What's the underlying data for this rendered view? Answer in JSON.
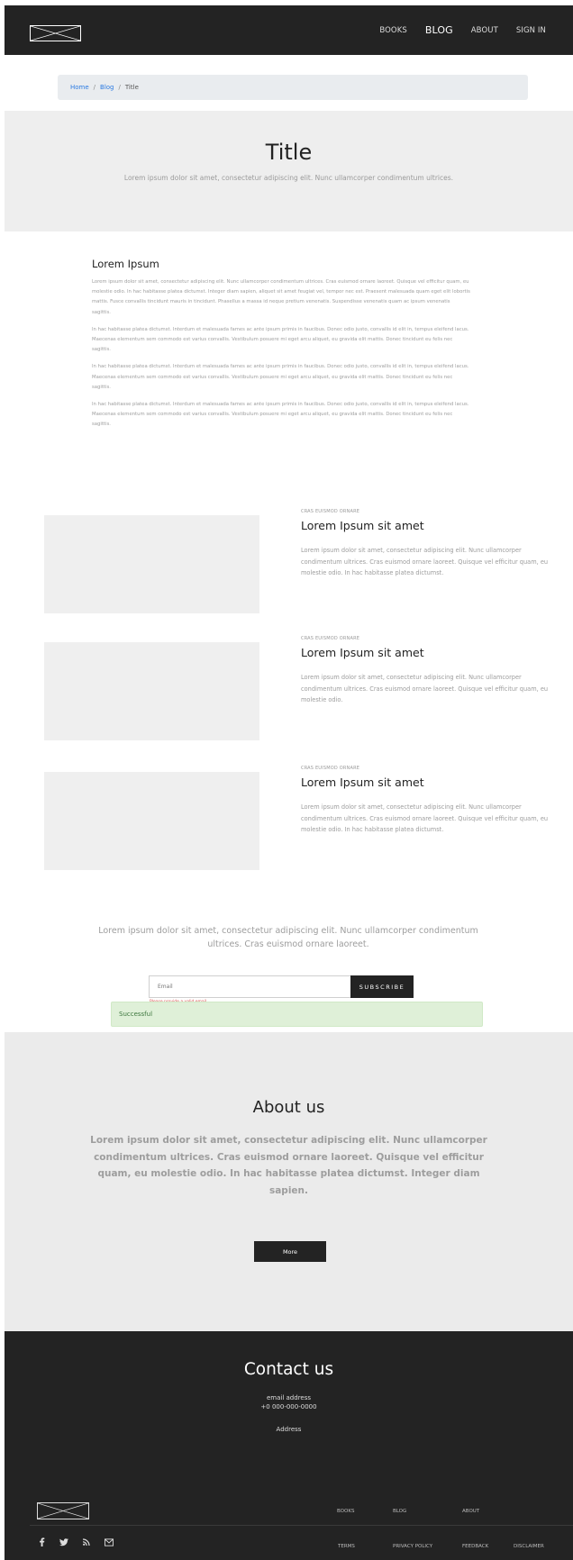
{
  "header": {
    "nav": [
      {
        "label": "BOOKS",
        "active": false
      },
      {
        "label": "BLOG",
        "active": true
      },
      {
        "label": "ABOUT",
        "active": false
      },
      {
        "label": "SIGN IN",
        "active": false
      }
    ]
  },
  "breadcrumb": {
    "home": "Home",
    "blog": "Blog",
    "current": "Title",
    "separator": "/"
  },
  "hero": {
    "title": "Title",
    "subtitle": "Lorem ipsum dolor sit amet, consectetur adipiscing elit. Nunc ullamcorper condimentum ultrices."
  },
  "article": {
    "heading": "Lorem Ipsum",
    "paragraphs": [
      "Lorem ipsum dolor sit amet, consectetur adipiscing elit. Nunc ullamcorper condimentum ultrices. Cras euismod ornare laoreet. Quisque vel efficitur quam, eu molestie odio. In hac habitasse platea dictumst. Integer diam sapien, aliquet sit amet feugiat vel, tempor nec est. Praesent malesuada quam eget elit lobortis mattis. Fusce convallis tincidunt mauris in tincidunt. Phasellus a massa id neque pretium venenatis. Suspendisse venenatis quam ac ipsum venenatis sagittis.",
      "In hac habitasse platea dictumst. Interdum et malesuada fames ac ante ipsum primis in faucibus. Donec odio justo, convallis id elit in, tempus eleifend lacus. Maecenas elementum sem commodo est varius convallis. Vestibulum posuere mi eget arcu aliquet, eu gravida elit mattis. Donec tincidunt eu felis nec sagittis.",
      "In hac habitasse platea dictumst. Interdum et malesuada fames ac ante ipsum primis in faucibus. Donec odio justo, convallis id elit in, tempus eleifend lacus. Maecenas elementum sem commodo est varius convallis. Vestibulum posuere mi eget arcu aliquet, eu gravida elit mattis. Donec tincidunt eu felis nec sagittis.",
      "In hac habitasse platea dictumst. Interdum et malesuada fames ac ante ipsum primis in faucibus. Donec odio justo, convallis id elit in, tempus eleifend lacus. Maecenas elementum sem commodo est varius convallis. Vestibulum posuere mi eget arcu aliquet, eu gravida elit mattis. Donec tincidunt eu felis nec sagittis."
    ]
  },
  "posts": [
    {
      "category": "CRAS EUISMOD ORNARE",
      "title": "Lorem Ipsum sit amet",
      "excerpt": "Lorem ipsum dolor sit amet, consectetur adipiscing elit. Nunc ullamcorper condimentum ultrices. Cras euismod ornare laoreet. Quisque vel efficitur quam, eu molestie odio. In hac habitasse platea dictumst."
    },
    {
      "category": "CRAS EUISMOD ORNARE",
      "title": "Lorem Ipsum sit amet",
      "excerpt": "Lorem ipsum dolor sit amet, consectetur adipiscing elit. Nunc ullamcorper condimentum ultrices. Cras euismod ornare laoreet. Quisque vel efficitur quam, eu molestie odio."
    },
    {
      "category": "CRAS EUISMOD ORNARE",
      "title": "Lorem Ipsum sit amet",
      "excerpt": "Lorem ipsum dolor sit amet, consectetur adipiscing elit. Nunc ullamcorper condimentum ultrices. Cras euismod ornare laoreet. Quisque vel efficitur quam, eu molestie odio. In hac habitasse platea dictumst."
    }
  ],
  "subscribe": {
    "text": "Lorem ipsum dolor sit amet, consectetur adipiscing elit. Nunc ullamcorper condimentum ultrices. Cras euismod ornare laoreet.",
    "placeholder": "Email",
    "button": "SUBSCRIBE",
    "error": "Please provide a valid email",
    "success": "Successful"
  },
  "about": {
    "title": "About us",
    "text": "Lorem ipsum dolor sit amet, consectetur adipiscing elit. Nunc ullamcorper condimentum ultrices. Cras euismod ornare laoreet. Quisque vel efficitur quam, eu molestie odio. In hac habitasse platea dictumst. Integer diam sapien.",
    "button": "More"
  },
  "contact": {
    "title": "Contact us",
    "email": "email address",
    "phone": "+0 000-000-0000",
    "address": "Address"
  },
  "footer": {
    "links_top": [
      "BOOKS",
      "BLOG",
      "ABOUT"
    ],
    "links_bottom": [
      "TERMS",
      "PRIVACY POLICY",
      "FEEDBACK",
      "DISCLAIMER"
    ],
    "social_icons": [
      "facebook-icon",
      "twitter-icon",
      "rss-icon",
      "mail-icon"
    ]
  },
  "colors": {
    "dark": "#232323",
    "hero_bg": "#eeeeee",
    "link": "#2a7ae2",
    "success_bg": "#dff0d8",
    "error": "#d9534f"
  }
}
